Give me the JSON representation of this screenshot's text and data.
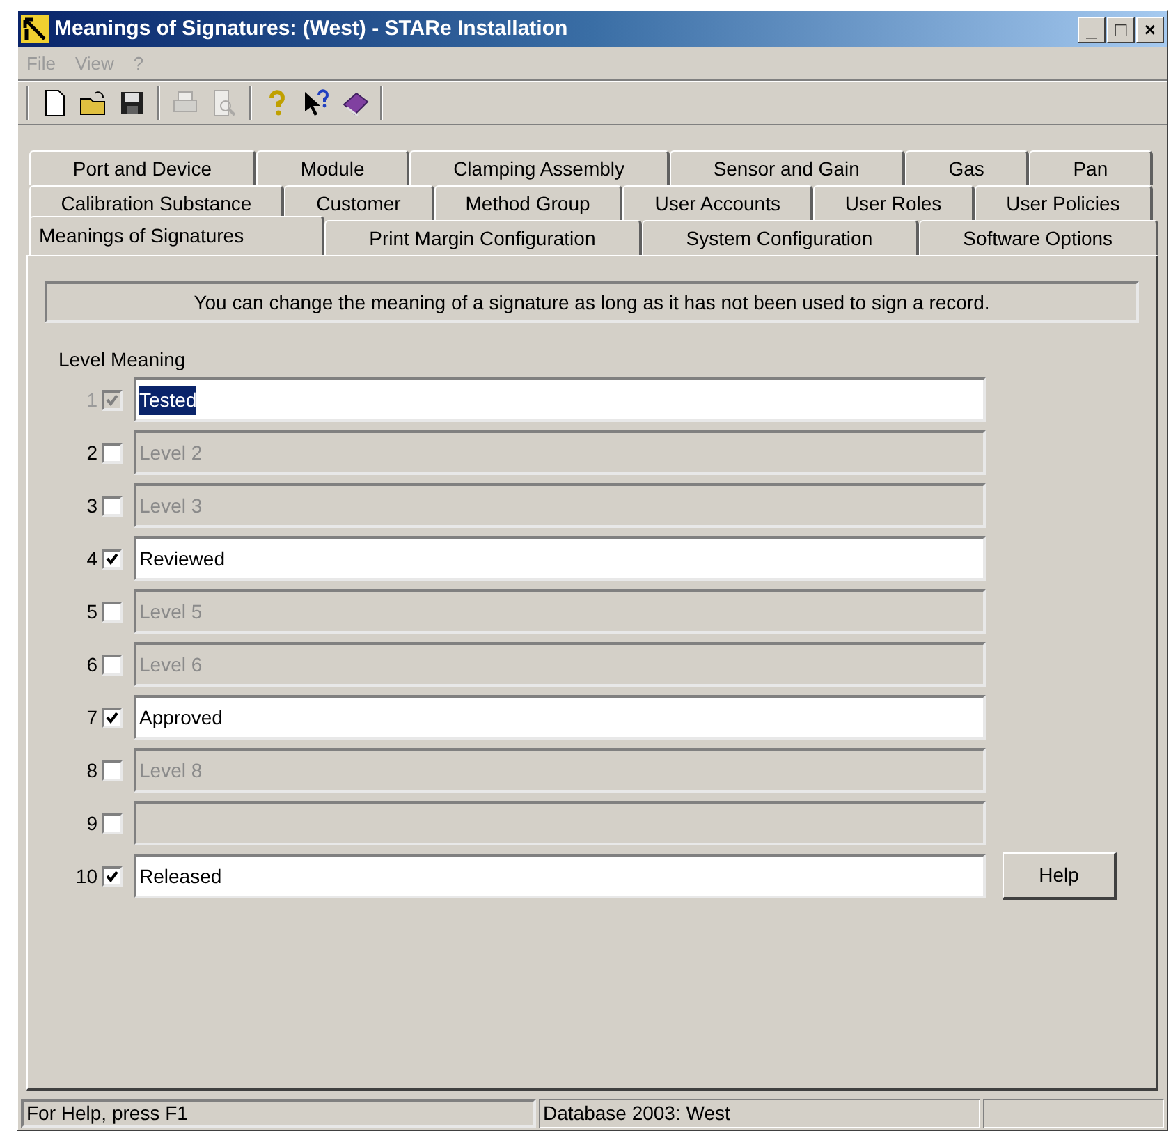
{
  "window": {
    "title": "Meanings of Signatures: (West) - STARe Installation",
    "controls": [
      "_",
      "□",
      "×"
    ]
  },
  "menu": [
    {
      "label": "File",
      "disabled": true
    },
    {
      "label": "View",
      "disabled": true
    },
    {
      "label": "?",
      "disabled": true
    }
  ],
  "toolbar": [
    {
      "kind": "new",
      "disabled": false
    },
    {
      "kind": "open",
      "disabled": false
    },
    {
      "kind": "save",
      "disabled": false
    },
    {
      "kind": "sep"
    },
    {
      "kind": "print",
      "disabled": true
    },
    {
      "kind": "preview",
      "disabled": true
    },
    {
      "kind": "sep"
    },
    {
      "kind": "help",
      "disabled": false
    },
    {
      "kind": "context-help",
      "disabled": false
    },
    {
      "kind": "book",
      "disabled": false
    }
  ],
  "tab_rows": [
    [
      {
        "label": "Port and Device",
        "selected": false
      },
      {
        "label": "Module",
        "selected": false
      },
      {
        "label": "Clamping Assembly",
        "selected": false
      },
      {
        "label": "Sensor and Gain",
        "selected": false
      },
      {
        "label": "Gas",
        "selected": false
      },
      {
        "label": "Pan",
        "selected": false
      }
    ],
    [
      {
        "label": "Calibration Substance",
        "selected": false
      },
      {
        "label": "Customer",
        "selected": false
      },
      {
        "label": "Method Group",
        "selected": false
      },
      {
        "label": "User Accounts",
        "selected": false
      },
      {
        "label": "User Roles",
        "selected": false
      },
      {
        "label": "User Policies",
        "selected": false
      }
    ],
    [
      {
        "label": "Meanings of Signatures",
        "selected": true
      },
      {
        "label": "Print Margin Configuration",
        "selected": false
      },
      {
        "label": "System Configuration",
        "selected": false
      },
      {
        "label": "Software Options",
        "selected": false
      }
    ]
  ],
  "notice": "You can change the meaning of a signature as long as it has not been used to sign a record.",
  "columns": [
    "Level",
    "Meaning"
  ],
  "rows": [
    {
      "level": "1",
      "checked": true,
      "check_disabled": true,
      "enabled": true,
      "highlighted": true,
      "value": "Tested"
    },
    {
      "level": "2",
      "checked": false,
      "check_disabled": false,
      "enabled": false,
      "highlighted": false,
      "value": "Level 2"
    },
    {
      "level": "3",
      "checked": false,
      "check_disabled": false,
      "enabled": false,
      "highlighted": false,
      "value": "Level 3"
    },
    {
      "level": "4",
      "checked": true,
      "check_disabled": false,
      "enabled": true,
      "highlighted": false,
      "value": "Reviewed"
    },
    {
      "level": "5",
      "checked": false,
      "check_disabled": false,
      "enabled": false,
      "highlighted": false,
      "value": "Level 5"
    },
    {
      "level": "6",
      "checked": false,
      "check_disabled": false,
      "enabled": false,
      "highlighted": false,
      "value": "Level 6"
    },
    {
      "level": "7",
      "checked": true,
      "check_disabled": false,
      "enabled": true,
      "highlighted": false,
      "value": "Approved"
    },
    {
      "level": "8",
      "checked": false,
      "check_disabled": false,
      "enabled": false,
      "highlighted": false,
      "value": "Level 8"
    },
    {
      "level": "9",
      "checked": false,
      "check_disabled": false,
      "enabled": false,
      "highlighted": false
    },
    {
      "level": "10",
      "checked": true,
      "check_disabled": false,
      "enabled": true,
      "highlighted": false,
      "value": "Released"
    }
  ],
  "help_button": "Help",
  "status_bar": [
    "For Help, press F1",
    "Database 2003: West"
  ]
}
